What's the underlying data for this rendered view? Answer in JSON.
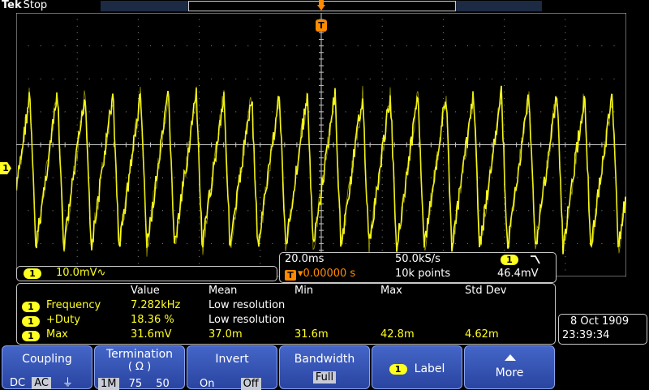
{
  "brand": {
    "name": "Tek",
    "state": "Stop"
  },
  "channel": {
    "number": "1",
    "scale": "10.0mV",
    "bw_symbol": "∿"
  },
  "horizontal": {
    "timebase": "20.0ms",
    "sample_rate": "50.0kS/s",
    "trigger_channel": "1",
    "trigger_slope_symbol": "⌐",
    "trigger_delay": "▾0.00000 s",
    "record_length": "10k points",
    "trigger_level": "46.4mV"
  },
  "measurements": {
    "headers": [
      "Value",
      "Mean",
      "Min",
      "Max",
      "Std Dev"
    ],
    "rows": [
      {
        "ch": "1",
        "name": "Frequency",
        "value": "7.282kHz",
        "mean": "Low resolution",
        "min": "",
        "max": "",
        "std": ""
      },
      {
        "ch": "1",
        "name": "+Duty",
        "value": "18.36 %",
        "mean": "Low resolution",
        "min": "",
        "max": "",
        "std": ""
      },
      {
        "ch": "1",
        "name": "Max",
        "value": "31.6mV",
        "mean": "37.0m",
        "min": "31.6m",
        "max": "42.8m",
        "std": "4.62m"
      }
    ]
  },
  "datetime": {
    "date": "8 Oct  1909",
    "time": "23:39:34"
  },
  "softkeys": {
    "coupling": {
      "label": "Coupling",
      "options": [
        "DC",
        "AC",
        "⏚"
      ],
      "selected": "AC"
    },
    "termination": {
      "label": "Termination",
      "sublabel": "( Ω )",
      "options": [
        "1M",
        "75",
        "50"
      ],
      "selected": "1M"
    },
    "invert": {
      "label": "Invert",
      "options": [
        "On",
        "Off"
      ],
      "selected": "Off"
    },
    "bandwidth": {
      "label": "Bandwidth",
      "value": "Full"
    },
    "label": {
      "channel": "1",
      "label": "Label"
    },
    "more": {
      "label": "More"
    }
  },
  "colors": {
    "trace": "#ffff20",
    "trigger_marker": "#ff8a00",
    "softkey": "#3656b8",
    "grid": "#8c8c8c"
  },
  "markers": {
    "trigger_marker": "T",
    "ground_marker": "1"
  }
}
